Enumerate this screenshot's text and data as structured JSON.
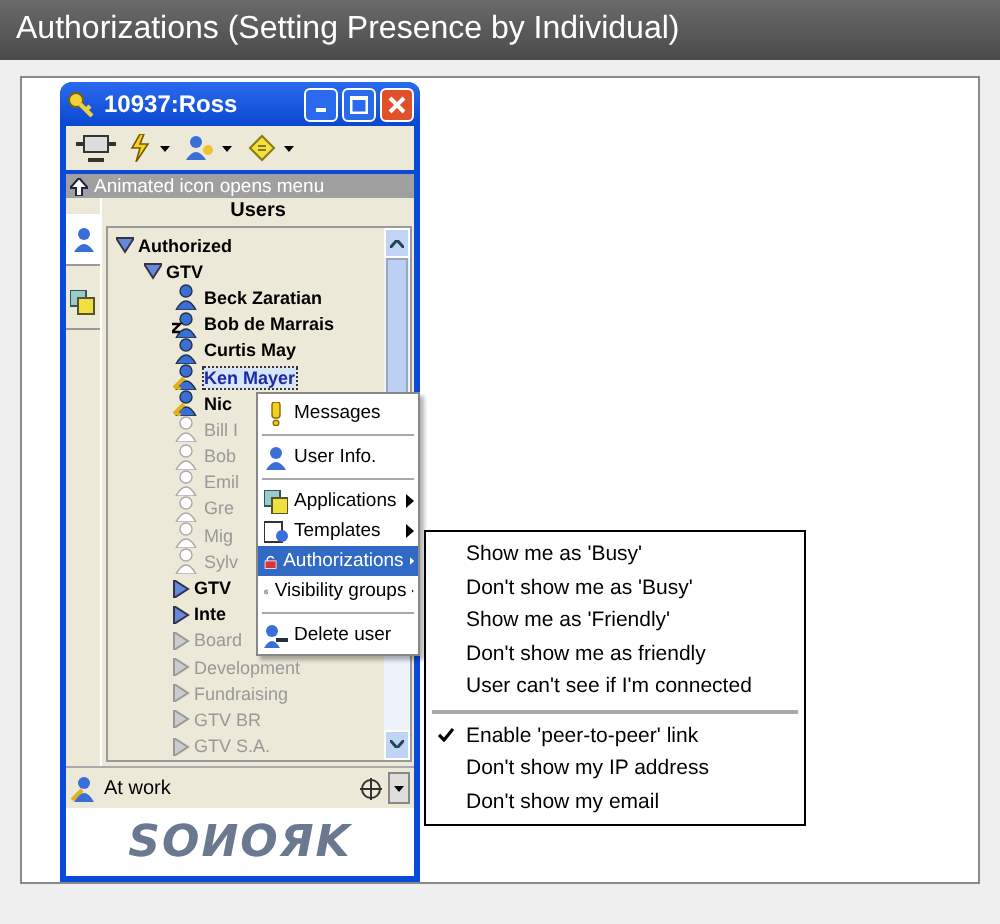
{
  "page_title": "Authorizations (Setting Presence by Individual)",
  "window": {
    "title": "10937:Ross",
    "hint": "Animated icon opens menu",
    "tree_header": "Users",
    "status": "At work",
    "logo": "SOИOЯK",
    "side_tabs": [
      {
        "selected": true
      },
      {
        "selected": false
      }
    ],
    "tree": [
      {
        "kind": "group",
        "label": "Authorized",
        "expanded": true,
        "disabled": false,
        "children": [
          {
            "kind": "group",
            "label": "GTV",
            "expanded": true,
            "disabled": false,
            "children": [
              {
                "kind": "online-user",
                "label": "Beck Zaratian",
                "selected": false
              },
              {
                "kind": "away-user",
                "label": "Bob de Marrais",
                "selected": false
              },
              {
                "kind": "online-user",
                "label": "Curtis May",
                "selected": false
              },
              {
                "kind": "key-user",
                "label": "Ken Mayer",
                "selected": true
              },
              {
                "kind": "key-user",
                "label": "Nic",
                "selected": false
              },
              {
                "kind": "offline-user",
                "label": "Bill I",
                "selected": false
              },
              {
                "kind": "offline-user",
                "label": "Bob",
                "selected": false
              },
              {
                "kind": "offline-user",
                "label": "Emil",
                "selected": false
              },
              {
                "kind": "offline-user",
                "label": "Gre",
                "selected": false
              },
              {
                "kind": "offline-user",
                "label": "Mig",
                "selected": false
              },
              {
                "kind": "offline-user",
                "label": "Sylv",
                "selected": false
              },
              {
                "kind": "group",
                "label": "GTV",
                "expanded": false,
                "disabled": false
              },
              {
                "kind": "group",
                "label": "Inte",
                "expanded": false,
                "disabled": false
              },
              {
                "kind": "group",
                "label": "Board",
                "expanded": false,
                "disabled": true
              },
              {
                "kind": "group",
                "label": "Development",
                "expanded": false,
                "disabled": true
              },
              {
                "kind": "group",
                "label": "Fundraising",
                "expanded": false,
                "disabled": true
              },
              {
                "kind": "group",
                "label": "GTV BR",
                "expanded": false,
                "disabled": true
              },
              {
                "kind": "group",
                "label": "GTV S.A.",
                "expanded": false,
                "disabled": true
              }
            ]
          }
        ]
      }
    ]
  },
  "context_menu": {
    "sections": [
      [
        {
          "label": "Messages",
          "has_submenu": false,
          "selected": false
        }
      ],
      [
        {
          "label": "User Info.",
          "has_submenu": false,
          "selected": false
        }
      ],
      [
        {
          "label": "Applications",
          "has_submenu": true,
          "selected": false
        },
        {
          "label": "Templates",
          "has_submenu": true,
          "selected": false
        },
        {
          "label": "Authorizations",
          "has_submenu": true,
          "selected": true
        },
        {
          "label": "Visibility groups",
          "has_submenu": true,
          "selected": false
        }
      ],
      [
        {
          "label": "Delete user",
          "has_submenu": false,
          "selected": false
        }
      ]
    ]
  },
  "submenu": {
    "sections": [
      [
        {
          "label": "Show me as 'Busy'",
          "checked": false
        },
        {
          "label": "Don't show me as 'Busy'",
          "checked": false
        },
        {
          "label": "Show me as 'Friendly'",
          "checked": false
        },
        {
          "label": "Don't show me as friendly",
          "checked": false
        },
        {
          "label": "User can't see if I'm connected",
          "checked": false
        }
      ],
      [
        {
          "label": "Enable 'peer-to-peer' link",
          "checked": true
        },
        {
          "label": "Don't show my IP address",
          "checked": false
        },
        {
          "label": "Don't show my email",
          "checked": false
        }
      ]
    ]
  }
}
